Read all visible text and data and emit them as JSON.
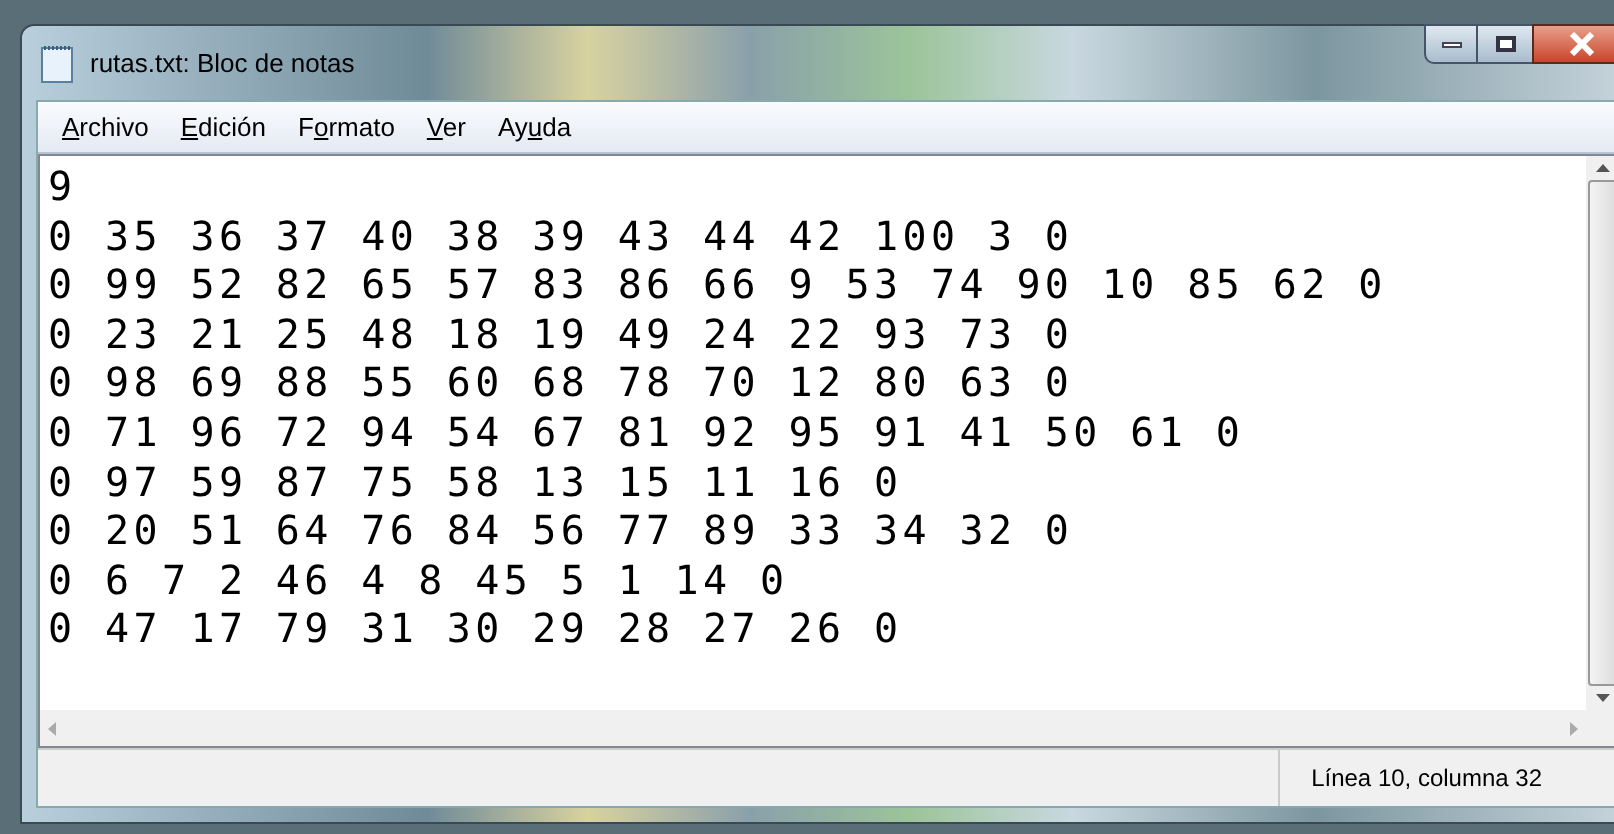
{
  "window": {
    "title": "rutas.txt: Bloc de notas"
  },
  "menu": [
    {
      "key": "A",
      "after": "rchivo"
    },
    {
      "key": "E",
      "after": "dición"
    },
    {
      "before": "F",
      "key": "o",
      "after": "rmato"
    },
    {
      "key": "V",
      "after": "er"
    },
    {
      "before": "Ay",
      "key": "u",
      "after": "da"
    }
  ],
  "lines": [
    "9",
    "0 35 36 37 40 38 39 43 44 42 100 3 0",
    "0 99 52 82 65 57 83 86 66 9 53 74 90 10 85 62 0",
    "0 23 21 25 48 18 19 49 24 22 93 73 0",
    "0 98 69 88 55 60 68 78 70 12 80 63 0",
    "0 71 96 72 94 54 67 81 92 95 91 41 50 61 0",
    "0 97 59 87 75 58 13 15 11 16 0",
    "0 20 51 64 76 84 56 77 89 33 34 32 0",
    "0 6 7 2 46 4 8 45 5 1 14 0",
    "0 47 17 79 31 30 29 28 27 26 0"
  ],
  "status_bar": {
    "position": "Línea 10, columna 32"
  }
}
